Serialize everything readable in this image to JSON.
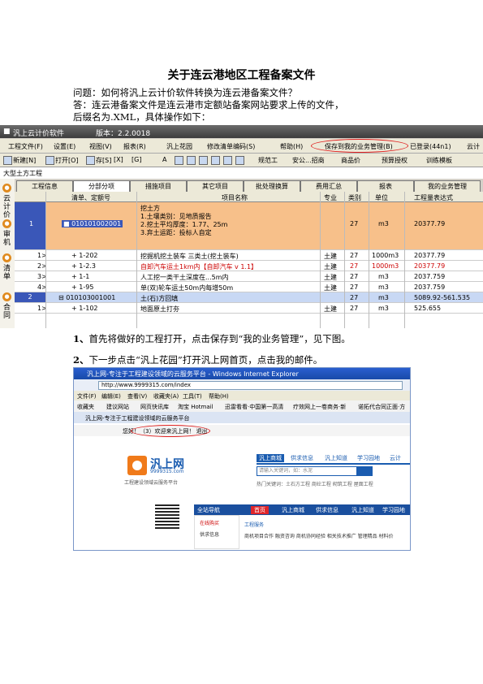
{
  "doc": {
    "title": "关于连云港地区工程备案文件",
    "question": "问题：如何将汎上云计价软件转换为连云港备案文件？",
    "answer_line1": "答：连云港备案文件是连云港市定额站备案网站要求上传的文件，",
    "answer_line2": "后缀名为.XML，具体操作如下：",
    "step1_num": "1、",
    "step1_text": "首先将做好的工程打开，点击保存到“我的业务管理”，见下图。",
    "step2_num": "2、",
    "step2_text": "下一步点击“汎上花园”打开汎上网首页，点击我的邮件。"
  },
  "shot1": {
    "app_title": "汎上云计价软件",
    "version": "版本：2.2.0018",
    "menu": [
      "工程文件(F)",
      "设置(E)",
      "视图(V)",
      "报表(R)",
      "汎上花园",
      "修改清单编码(S)",
      "帮助(H)",
      "保存到我的业务管理(B)",
      "已登录(44n1)",
      "云计"
    ],
    "toolbar": [
      "新建[N]",
      "打开[O]",
      "存[S]",
      "[X]",
      "[G]",
      "A",
      "规范工",
      "安公...招商",
      "商品价",
      "预算授权",
      "训练模板"
    ],
    "project": "大型土方工程",
    "side_labels": [
      "云计价",
      "审机",
      "计价",
      "清单",
      "合同"
    ],
    "tabs": [
      "工程信息",
      "分部分项",
      "措施项目",
      "其它项目",
      "批处理换算",
      "费用汇总",
      "报表",
      "我的业务管理"
    ],
    "headers": [
      "清单、定额号",
      "项目名称",
      "专业",
      "类别",
      "单位",
      "工程量表达式"
    ],
    "rows": [
      {
        "c0": "1",
        "c1": "■ 010101002001",
        "c2": "挖土方",
        "c2b": "1.土壤类别：见地质报告",
        "c2c": "2.挖土平均厚度：1.77、25m",
        "c2d": "3.弃土运距：投标人自定",
        "c3": "",
        "c4": "27",
        "c5": "m3",
        "c6": "20377.79"
      },
      {
        "c0": "1>",
        "c1": "+ 1-202",
        "c2": "挖掘机挖土装车 三类土(挖土装车)",
        "c3": "土建",
        "c4": "27",
        "c5": "1000m3",
        "c6": "20377.79"
      },
      {
        "c0": "2>",
        "c1": "+ 1-2.3",
        "c2": "自卸汽车运土1km内【自卸汽车 v 1.1】",
        "c3": "土建",
        "c4": "27",
        "c5": "1000m3",
        "c6": "20377.79"
      },
      {
        "c0": "3>",
        "c1": "+ 1-1",
        "c2": "人工挖一类干土深度在...5m内",
        "c3": "土建",
        "c4": "27",
        "c5": "m3",
        "c6": "2037.759"
      },
      {
        "c0": "4>",
        "c1": "+ 1-95",
        "c2": "单(双)轮车运土50m内每增50m",
        "c3": "土建",
        "c4": "27",
        "c5": "m3",
        "c6": "2037.759"
      },
      {
        "c0": "2",
        "c1": "⊟ 010103001001",
        "c2": "土(石)方回填",
        "c3": "",
        "c4": "27",
        "c5": "m3",
        "c6": "5089.92-561.535"
      },
      {
        "c0": "1>",
        "c1": "+ 1-102",
        "c2": "地面原土打夯",
        "c3": "土建",
        "c4": "27",
        "c5": "m3",
        "c6": "525.655"
      }
    ]
  },
  "shot2": {
    "window_title": "汎上网-专注于工程建设领域的云服务平台 - Windows Internet Explorer",
    "url": "http://www.9999315.com/index",
    "menu": [
      "文件(F)",
      "编辑(E)",
      "查看(V)",
      "收藏夹(A)",
      "工具(T)",
      "帮助(H)"
    ],
    "favorites": [
      "收藏夹",
      "建议网站",
      "网页快讯库",
      "淘宝 Hotmail",
      "迅雷看看·中国第一高清",
      "疗效网上一卷商务·新",
      "诺拓代合同正面·方"
    ],
    "tab_title": "汎上网-专注于工程建设领域的云服务平台",
    "user_bar": "您好！（3）欢迎来汎上网！ 退出",
    "logo_text": "汎上网",
    "logo_url": "9999315.com",
    "slogan": "工程建设领域云服务平台",
    "site_nav": [
      "汎上商城",
      "供求信息",
      "汎上知道",
      "学习园地",
      "云计"
    ],
    "search_placeholder": "请输入关键词，如：水泥",
    "hot_keywords": "热门关键词：土石方工程  商砼工程  砌筑工程  屋面工程",
    "blue_nav": [
      "全站导航",
      "首页",
      "汎上商城",
      "供求信息",
      "汎上知道",
      "学习园地"
    ],
    "left_items": [
      "在线购买",
      "供求信息"
    ],
    "service_title": "工程服务",
    "service_items": "商机项目合作  融资咨询  商机协同经验  相关技术推广  管理精品  材料价"
  },
  "colors": {
    "orange_row": "#f7c08a",
    "selected": "#3a57b8",
    "red_text": "#cc0000",
    "ie_blue": "#1a5cb0"
  }
}
